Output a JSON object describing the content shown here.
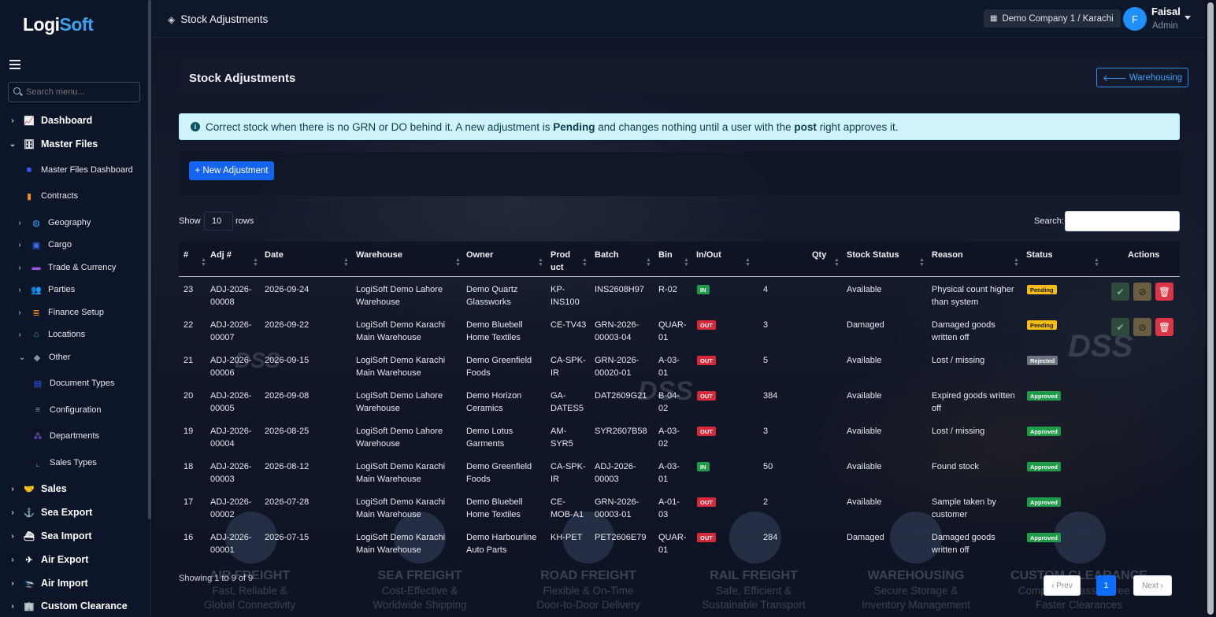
{
  "app": {
    "logo_a": "Logi",
    "logo_b": "Soft",
    "page_title": "Stock Adjustments"
  },
  "sidebar": {
    "search_placeholder": "Search menu...",
    "items": [
      {
        "label": "Dashboard",
        "icon": "chart-line-icon",
        "expanded": false
      },
      {
        "label": "Master Files",
        "icon": "database-icon",
        "expanded": true
      },
      {
        "label": "Master Files Dashboard",
        "icon": "square-icon"
      },
      {
        "label": "Contracts",
        "icon": "file-icon"
      },
      {
        "label": "Geography",
        "icon": "globe-icon"
      },
      {
        "label": "Cargo",
        "icon": "box-icon"
      },
      {
        "label": "Trade & Currency",
        "icon": "money-icon"
      },
      {
        "label": "Parties",
        "icon": "users-icon"
      },
      {
        "label": "Finance Setup",
        "icon": "coins-icon"
      },
      {
        "label": "Locations",
        "icon": "warehouse-icon"
      },
      {
        "label": "Other",
        "icon": "tags-icon"
      },
      {
        "label": "Document Types",
        "icon": "id-card-icon"
      },
      {
        "label": "Configuration",
        "icon": "sliders-icon"
      },
      {
        "label": "Departments",
        "icon": "sitemap-icon"
      },
      {
        "label": "Sales Types",
        "icon": "chart-icon"
      },
      {
        "label": "Sales",
        "icon": "handshake-icon"
      },
      {
        "label": "Sea Export",
        "icon": "anchor-icon"
      },
      {
        "label": "Sea Import",
        "icon": "ship-icon"
      },
      {
        "label": "Air Export",
        "icon": "plane-icon"
      },
      {
        "label": "Air Import",
        "icon": "plane-arrival-icon"
      },
      {
        "label": "Custom Clearance",
        "icon": "building-icon"
      }
    ]
  },
  "header": {
    "company": "Demo Company 1 / Karachi",
    "user_initial": "F",
    "user_name": "Faisal",
    "user_role": "Admin"
  },
  "card": {
    "title": "Stock Adjustments",
    "back_label": "Warehousing"
  },
  "alert": {
    "p1": "Correct stock when there is no GRN or DO behind it. A new adjustment is ",
    "b1": "Pending",
    "p2": " and changes nothing until a user with the ",
    "b2": "post",
    "p3": " right approves it."
  },
  "new_button": "+ New Adjustment",
  "table_controls": {
    "show": "Show",
    "rows_value": "10",
    "rows": "rows",
    "search": "Search:"
  },
  "columns": [
    "#",
    "Adj #",
    "Date",
    "Warehouse",
    "Owner",
    "Prod\nuct",
    "Batch",
    "Bin",
    "In/Out",
    "Qty",
    "Stock Status",
    "Reason",
    "Status",
    "Actions"
  ],
  "rows": [
    {
      "n": "23",
      "adj": "ADJ-2026-\n00008",
      "date": "2026-09-24",
      "wh": "LogiSoft Demo Lahore\nWarehouse",
      "owner": "Demo Quartz\nGlassworks",
      "prod": "KP-\nINS100",
      "batch": "INS2608H97",
      "bin": "R-02",
      "io": "IN",
      "qty": "4",
      "ss": "Available",
      "reason": "Physical count higher\nthan system",
      "status": "Pending",
      "actions": true
    },
    {
      "n": "22",
      "adj": "ADJ-2026-\n00007",
      "date": "2026-09-22",
      "wh": "LogiSoft Demo Karachi\nMain Warehouse",
      "owner": "Demo Bluebell\nHome Textiles",
      "prod": "CE-TV43",
      "batch": "GRN-2026-\n00003-04",
      "bin": "QUAR-\n01",
      "io": "OUT",
      "qty": "3",
      "ss": "Damaged",
      "reason": "Damaged goods\nwritten off",
      "status": "Pending",
      "actions": true
    },
    {
      "n": "21",
      "adj": "ADJ-2026-\n00006",
      "date": "2026-09-15",
      "wh": "LogiSoft Demo Karachi\nMain Warehouse",
      "owner": "Demo Greenfield\nFoods",
      "prod": "CA-SPK-\nIR",
      "batch": "GRN-2026-\n00020-01",
      "bin": "A-03-\n01",
      "io": "OUT",
      "qty": "5",
      "ss": "Available",
      "reason": "Lost / missing",
      "status": "Rejected",
      "actions": false
    },
    {
      "n": "20",
      "adj": "ADJ-2026-\n00005",
      "date": "2026-09-08",
      "wh": "LogiSoft Demo Lahore\nWarehouse",
      "owner": "Demo Horizon\nCeramics",
      "prod": "GA-\nDATES5",
      "batch": "DAT2609G21",
      "bin": "B-04-\n02",
      "io": "OUT",
      "qty": "384",
      "ss": "Available",
      "reason": "Expired goods written\noff",
      "status": "Approved",
      "actions": false
    },
    {
      "n": "19",
      "adj": "ADJ-2026-\n00004",
      "date": "2026-08-25",
      "wh": "LogiSoft Demo Lahore\nWarehouse",
      "owner": "Demo Lotus\nGarments",
      "prod": "AM-\nSYR5",
      "batch": "SYR2607B58",
      "bin": "A-03-\n02",
      "io": "OUT",
      "qty": "3",
      "ss": "Available",
      "reason": "Lost / missing",
      "status": "Approved",
      "actions": false
    },
    {
      "n": "18",
      "adj": "ADJ-2026-\n00003",
      "date": "2026-08-12",
      "wh": "LogiSoft Demo Karachi\nMain Warehouse",
      "owner": "Demo Greenfield\nFoods",
      "prod": "CA-SPK-\nIR",
      "batch": "ADJ-2026-\n00003",
      "bin": "A-03-\n01",
      "io": "IN",
      "qty": "50",
      "ss": "Available",
      "reason": "Found stock",
      "status": "Approved",
      "actions": false
    },
    {
      "n": "17",
      "adj": "ADJ-2026-\n00002",
      "date": "2026-07-28",
      "wh": "LogiSoft Demo Karachi\nMain Warehouse",
      "owner": "Demo Bluebell\nHome Textiles",
      "prod": "CE-\nMOB-A1",
      "batch": "GRN-2026-\n00003-01",
      "bin": "A-01-\n03",
      "io": "OUT",
      "qty": "2",
      "ss": "Available",
      "reason": "Sample taken by\ncustomer",
      "status": "Approved",
      "actions": false
    },
    {
      "n": "16",
      "adj": "ADJ-2026-\n00001",
      "date": "2026-07-15",
      "wh": "LogiSoft Demo Karachi\nMain Warehouse",
      "owner": "Demo Harbourline\nAuto Parts",
      "prod": "KH-PET",
      "batch": "PET2606E79",
      "bin": "QUAR-\n01",
      "io": "OUT",
      "qty": "284",
      "ss": "Damaged",
      "reason": "Damaged goods\nwritten off",
      "status": "Approved",
      "actions": false
    }
  ],
  "footer": {
    "info": "Showing 1 to 9 of 9",
    "prev": "‹ Prev",
    "page": "1",
    "next": "Next ›"
  },
  "background": {
    "watermark": "DSS",
    "services": [
      {
        "title": "AIR FREIGHT",
        "l1": "Fast, Reliable &",
        "l2": "Global Connectivity"
      },
      {
        "title": "SEA FREIGHT",
        "l1": "Cost-Effective &",
        "l2": "Worldwide Shipping"
      },
      {
        "title": "ROAD FREIGHT",
        "l1": "Flexible & On-Time",
        "l2": "Door-to-Door Delivery"
      },
      {
        "title": "RAIL FREIGHT",
        "l1": "Safe, Efficient &",
        "l2": "Sustainable Transport"
      },
      {
        "title": "WAREHOUSING",
        "l1": "Secure Storage &",
        "l2": "Inventory Management"
      },
      {
        "title": "CUSTOM CLEARANCE",
        "l1": "Compliant, Hassle-Free &",
        "l2": "Faster Clearances"
      }
    ]
  },
  "colors": {
    "accent": "#1464f0",
    "in": "#1f9b4a",
    "out": "#d8283a",
    "pending": "#f5bd15",
    "rejected": "#6c757d"
  }
}
